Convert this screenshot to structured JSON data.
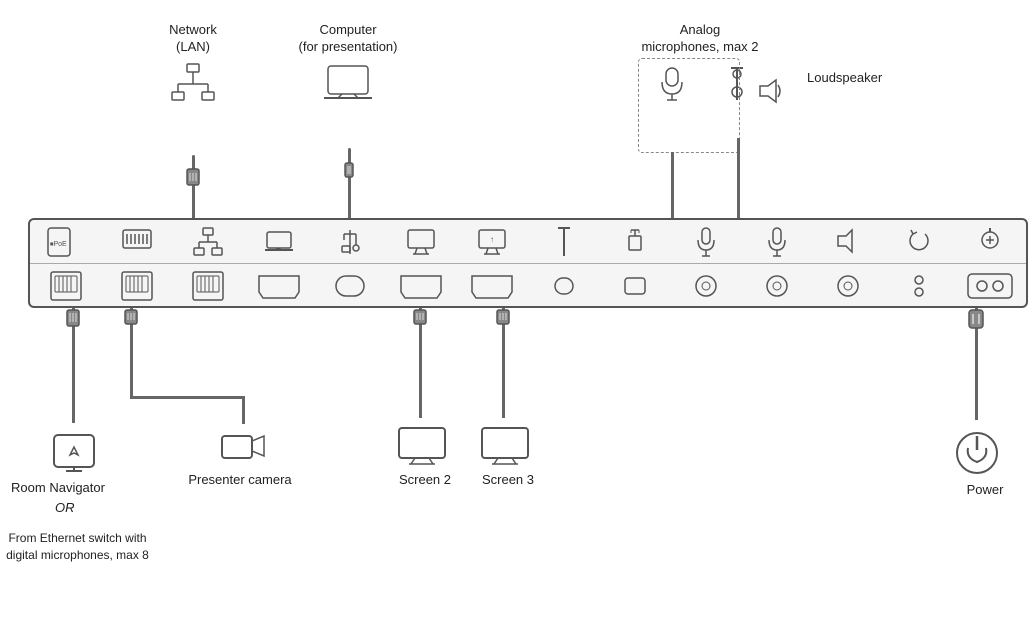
{
  "labels": {
    "network": "Network\n(LAN)",
    "computer": "Computer\n(for presentation)",
    "analog_mic": "Analog\nmicrophones, max 2",
    "loudspeaker": "Loudspeaker",
    "room_navigator": "Room Navigator",
    "or": "OR",
    "from_ethernet": "From Ethernet\nswitch with digital\nmicrophones,\nmax 8",
    "presenter_camera": "Presenter camera",
    "screen2": "Screen\n2",
    "screen3": "Screen\n3",
    "power": "Power"
  },
  "colors": {
    "panel_bg": "#f0f0f0",
    "panel_border": "#555",
    "cable": "#666",
    "icon": "#555",
    "dashed_border": "#888"
  }
}
